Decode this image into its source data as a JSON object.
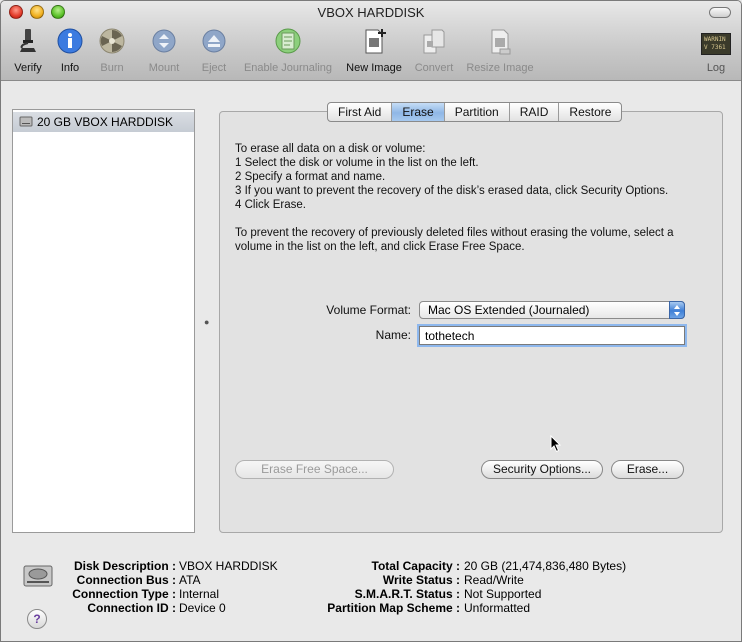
{
  "window": {
    "title": "VBOX HARDDISK"
  },
  "toolbar": {
    "items": [
      {
        "label": "Verify",
        "icon": "microscope-icon",
        "enabled": true
      },
      {
        "label": "Info",
        "icon": "info-icon",
        "enabled": true
      },
      {
        "label": "Burn",
        "icon": "burn-icon",
        "enabled": false
      },
      {
        "label": "Mount",
        "icon": "mount-icon",
        "enabled": false
      },
      {
        "label": "Eject",
        "icon": "eject-icon",
        "enabled": false
      },
      {
        "label": "Enable Journaling",
        "icon": "journal-icon",
        "enabled": false
      },
      {
        "label": "New Image",
        "icon": "new-image-icon",
        "enabled": true
      },
      {
        "label": "Convert",
        "icon": "convert-icon",
        "enabled": false
      },
      {
        "label": "Resize Image",
        "icon": "resize-image-icon",
        "enabled": false
      }
    ],
    "log": {
      "label": "Log",
      "icon_text": "WARNIN\nV 7361"
    }
  },
  "sidebar": {
    "items": [
      {
        "label": "20 GB VBOX HARDDISK",
        "selected": true
      }
    ]
  },
  "tabs": [
    {
      "label": "First Aid",
      "active": false
    },
    {
      "label": "Erase",
      "active": true
    },
    {
      "label": "Partition",
      "active": false
    },
    {
      "label": "RAID",
      "active": false
    },
    {
      "label": "Restore",
      "active": false
    }
  ],
  "erase": {
    "instructions": "To erase all data on a disk or volume:\n1 Select the disk or volume in the list on the left.\n2 Specify a format and name.\n3 If you want to prevent the recovery of the disk’s erased data, click Security Options.\n4 Click Erase.",
    "free_space_text": "To prevent the recovery of previously deleted files without erasing the volume, select a volume in the list on the left, and click Erase Free Space.",
    "volume_format_label": "Volume Format:",
    "volume_format_value": "Mac OS Extended (Journaled)",
    "name_label": "Name:",
    "name_value": "tothetech",
    "erase_free_space_button": "Erase Free Space...",
    "security_options_button": "Security Options...",
    "erase_button": "Erase..."
  },
  "info": {
    "left": [
      {
        "key": "Disk Description :",
        "value": "VBOX HARDDISK"
      },
      {
        "key": "Connection Bus :",
        "value": "ATA"
      },
      {
        "key": "Connection Type :",
        "value": "Internal"
      },
      {
        "key": "Connection ID :",
        "value": "Device 0"
      }
    ],
    "right": [
      {
        "key": "Total Capacity :",
        "value": "20 GB (21,474,836,480 Bytes)"
      },
      {
        "key": "Write Status :",
        "value": "Read/Write"
      },
      {
        "key": "S.M.A.R.T. Status :",
        "value": "Not Supported"
      },
      {
        "key": "Partition Map Scheme :",
        "value": "Unformatted"
      }
    ],
    "help_glyph": "?"
  },
  "colors": {
    "accent": "#8fb7e6",
    "focus_ring": "#8eb8ee"
  }
}
